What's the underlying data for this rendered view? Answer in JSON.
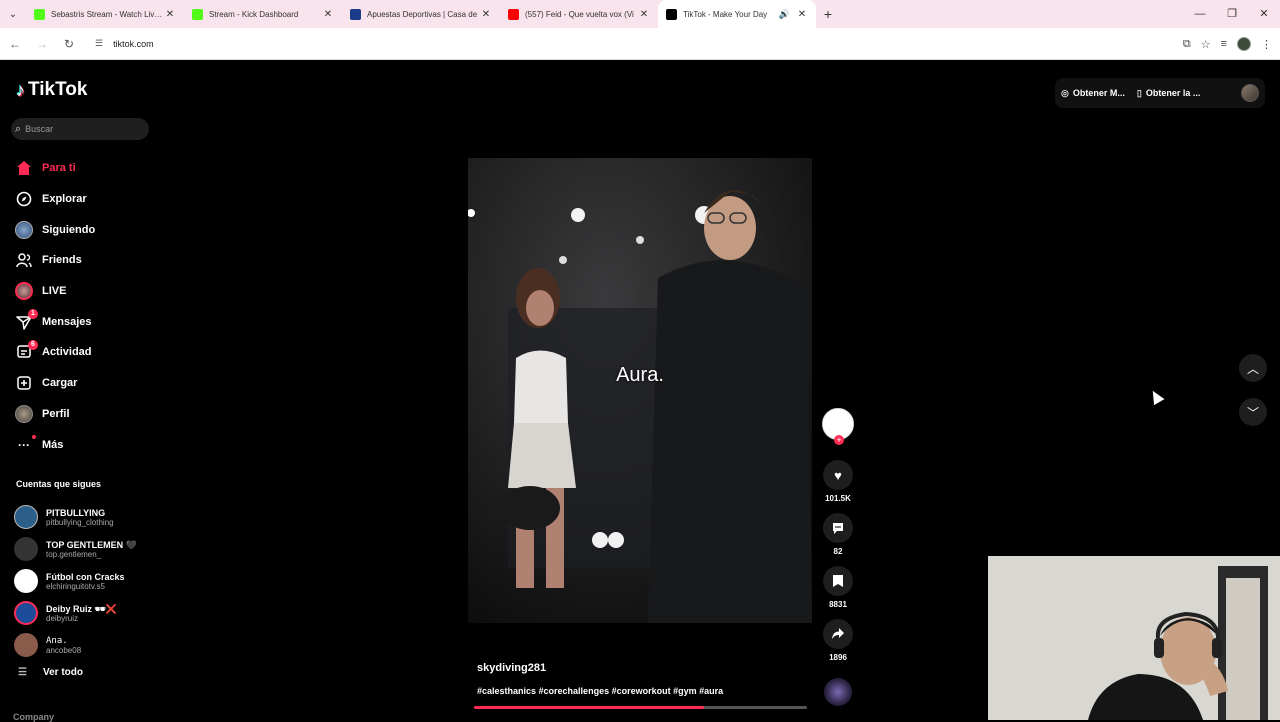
{
  "browser": {
    "tabs": [
      {
        "title": "Sebastris Stream - Watch Live o",
        "favicon_color": "#53fc18",
        "active": false
      },
      {
        "title": "Stream - Kick Dashboard",
        "favicon_color": "#53fc18",
        "active": false
      },
      {
        "title": "Apuestas Deportivas | Casa de",
        "favicon_color": "#1b3a8a",
        "active": false
      },
      {
        "title": "(557) Feid - Que vuelta vox (Vi",
        "favicon_color": "#ff0000",
        "active": false
      },
      {
        "title": "TikTok - Make Your Day",
        "favicon_color": "#000000",
        "active": true
      }
    ],
    "url": "tiktok.com"
  },
  "tiktok": {
    "brand": "TikTok",
    "search_placeholder": "Buscar",
    "nav": [
      {
        "label": "Para ti",
        "icon": "home-icon",
        "active": true
      },
      {
        "label": "Explorar",
        "icon": "compass-icon"
      },
      {
        "label": "Siguiendo",
        "icon": "following-avatar-icon"
      },
      {
        "label": "Friends",
        "icon": "friends-icon"
      },
      {
        "label": "LIVE",
        "icon": "live-avatar-icon"
      },
      {
        "label": "Mensajes",
        "icon": "paper-plane-icon",
        "badge": "1"
      },
      {
        "label": "Actividad",
        "icon": "activity-icon",
        "badge": "6"
      },
      {
        "label": "Cargar",
        "icon": "upload-icon"
      },
      {
        "label": "Perfil",
        "icon": "profile-avatar-icon"
      },
      {
        "label": "Más",
        "icon": "more-icon"
      }
    ],
    "following_title": "Cuentas que sigues",
    "following": [
      {
        "name": "PITBULLYING",
        "handle": "pitbullying_clothing",
        "color": "#2b5f8a"
      },
      {
        "name": "TOP GENTLEMEN 🖤",
        "handle": "top.gentlemen_",
        "color": "#333333"
      },
      {
        "name": "Fútbol con Cracks",
        "handle": "elchiringuitotv.s5",
        "color": "#ffffff"
      },
      {
        "name": "Deiby Ruiz 🕶❌",
        "handle": "deibyruiz",
        "color": "#1c4c9a"
      },
      {
        "name": "Ana.",
        "handle": "ancobe08",
        "color": "#8a5a4a"
      }
    ],
    "see_all": "Ver todo",
    "company": "Company",
    "top_right": {
      "get_coins": "Obtener M...",
      "get_app": "Obtener la ..."
    },
    "video": {
      "overlay_text": "Aura.",
      "author": "skydiving281",
      "tags": "#calesthanics #corechallenges #coreworkout #gym #aura",
      "progress": 0.69,
      "likes": "101.5K",
      "comments": "82",
      "saves": "8831",
      "shares": "1896"
    }
  }
}
